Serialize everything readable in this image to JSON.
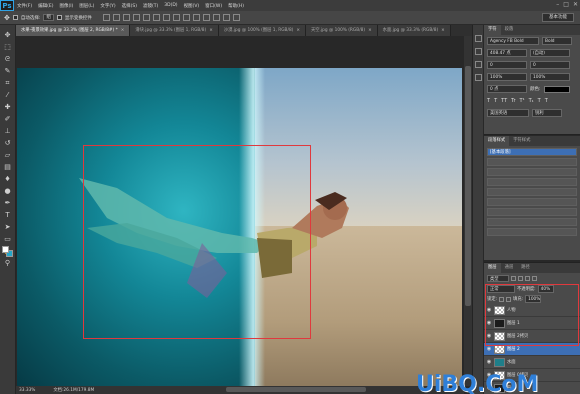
{
  "app": {
    "logo": "Ps"
  },
  "menu": [
    "文件(F)",
    "编辑(E)",
    "图像(I)",
    "图层(L)",
    "文字(Y)",
    "选择(S)",
    "滤镜(T)",
    "3D(D)",
    "视图(V)",
    "窗口(W)",
    "帮助(H)"
  ],
  "window_controls": [
    "–",
    "□",
    "✕"
  ],
  "options_bar": {
    "auto_select_label": "自动选择:",
    "auto_select_value": "组",
    "transform_label": "显示变换控件",
    "workspace": "基本功能"
  },
  "tabs": [
    {
      "label": "水果-夜景效果.jpg @ 33.3% (图层 2, RGB/8#) *",
      "active": true
    },
    {
      "label": "滑块.jpg @ 33.3% (图层 1, RGB/8)",
      "active": false
    },
    {
      "label": "沙漠.jpg @ 100% (图层 1, RGB/8)",
      "active": false
    },
    {
      "label": "天空.jpg @ 100% (RGB/8)",
      "active": false
    },
    {
      "label": "水面.jpg @ 33.3% (RGB/8)",
      "active": false
    }
  ],
  "status": {
    "zoom": "33.33%",
    "doc_size": "文档:26.1M/179.8M"
  },
  "character_panel": {
    "tabs": [
      "字符",
      "段落"
    ],
    "font_family": "Agency FB Bold",
    "font_style": "Bold",
    "font_size": "408.47 点",
    "leading": "(自动)",
    "kerning": "0",
    "tracking": "0",
    "scale_v": "100%",
    "scale_h": "100%",
    "baseline": "0 点",
    "color_label": "颜色:",
    "style_glyphs": [
      "T",
      "T",
      "TT",
      "Tr",
      "T¹",
      "T₁",
      "T",
      "T"
    ],
    "language": "美国英语",
    "antialias": "锐利"
  },
  "paragraph_panel": {
    "tabs": [
      "段落样式",
      "字符样式"
    ],
    "rows": [
      "[基本段落]",
      "",
      "",
      "",
      "",
      "",
      "",
      "",
      ""
    ]
  },
  "layers_panel": {
    "tabs": [
      "图层",
      "通道",
      "路径"
    ],
    "kind_label": "类型",
    "blend_mode": "正常",
    "opacity_label": "不透明度:",
    "opacity": "40%",
    "lock_label": "锁定:",
    "fill_label": "填充:",
    "fill": "100%",
    "layers": [
      {
        "name": "人物",
        "thumb": "check",
        "selected": false
      },
      {
        "name": "图层 1",
        "thumb": "dark",
        "selected": false
      },
      {
        "name": "图层 2拷贝",
        "thumb": "check",
        "selected": false
      },
      {
        "name": "图层 2",
        "thumb": "check",
        "selected": true
      },
      {
        "name": "水面",
        "thumb": "teal",
        "selected": false
      },
      {
        "name": "图层 0拷贝",
        "thumb": "check",
        "selected": false
      },
      {
        "name": "背景",
        "thumb": "dark",
        "selected": false
      }
    ]
  },
  "watermark": "UiBQ.CoM",
  "colors": {
    "accent": "#3d6fb5",
    "selection": "#e0393d",
    "fg": "#ffffff",
    "bg": "#25a6c8"
  }
}
